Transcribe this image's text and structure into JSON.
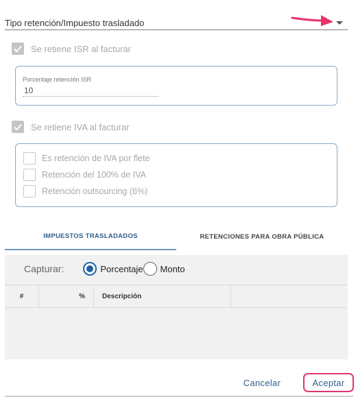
{
  "select": {
    "label": "Tipo retención/Impuesto trasladado",
    "caret_icon": "caret-down-icon"
  },
  "annotation": {
    "arrow_color": "#e8336c"
  },
  "isr": {
    "checkbox_label": "Se retiene ISR al facturar",
    "checked": true,
    "field_label": "Porcentaje retención ISR",
    "field_value": "10"
  },
  "iva": {
    "checkbox_label": "Se retiene IVA al facturar",
    "checked": true,
    "options": [
      {
        "label": "Es retención de IVA por flete",
        "checked": false
      },
      {
        "label": "Retención del 100% de IVA",
        "checked": false
      },
      {
        "label": "Retención outsourcing (6%)",
        "checked": false
      }
    ]
  },
  "tabs": [
    {
      "label": "IMPUESTOS TRASLADADOS",
      "active": true
    },
    {
      "label": "RETENCIONES PARA OBRA PÚBLICA",
      "active": false
    }
  ],
  "capture": {
    "label": "Capturar:",
    "options": [
      {
        "label": "Porcentaje",
        "selected": true
      },
      {
        "label": "Monto",
        "selected": false
      }
    ]
  },
  "table": {
    "columns": [
      "#",
      "%",
      "Descripción",
      ""
    ]
  },
  "footer": {
    "cancel_label": "Cancelar",
    "accept_label": "Aceptar",
    "highlight_color": "#e0356e"
  },
  "colors": {
    "accent": "#1d63a5",
    "link": "#2f5d8c",
    "box_border": "#87a9c7"
  }
}
